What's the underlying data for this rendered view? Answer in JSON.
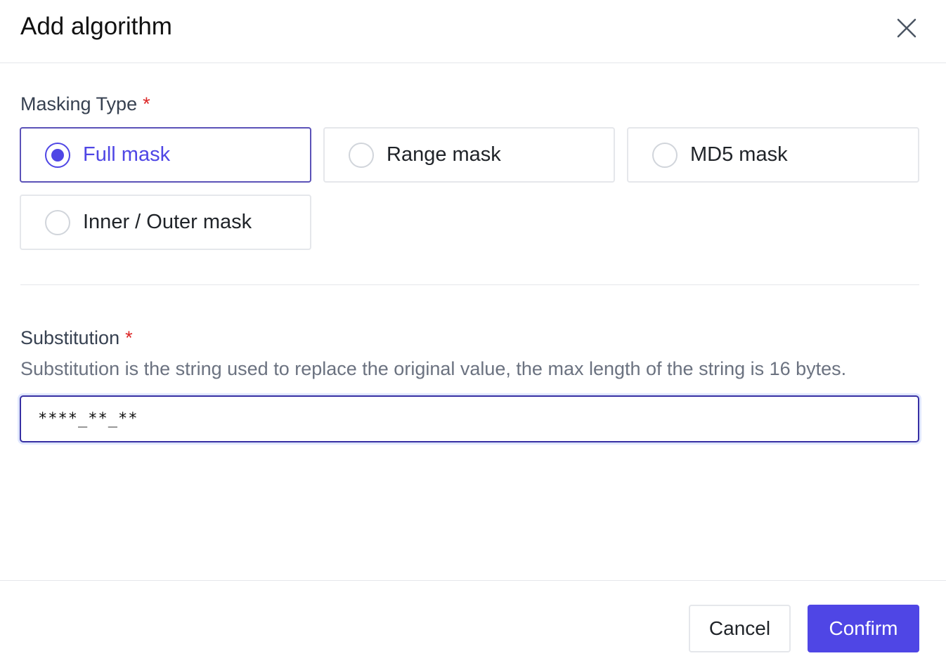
{
  "dialog": {
    "title": "Add algorithm",
    "close_icon": "close-icon"
  },
  "masking_type": {
    "label": "Masking Type",
    "required_mark": "*",
    "selected": "Full mask",
    "options": [
      {
        "label": "Full mask"
      },
      {
        "label": "Range mask"
      },
      {
        "label": "MD5 mask"
      },
      {
        "label": "Inner / Outer mask"
      }
    ]
  },
  "substitution": {
    "label": "Substitution",
    "required_mark": "*",
    "description": "Substitution is the string used to replace the original value, the max length of the string is 16 bytes.",
    "value": "****_**_**"
  },
  "footer": {
    "cancel_label": "Cancel",
    "confirm_label": "Confirm"
  },
  "colors": {
    "accent": "#4f46e5",
    "required": "#dc2626"
  }
}
